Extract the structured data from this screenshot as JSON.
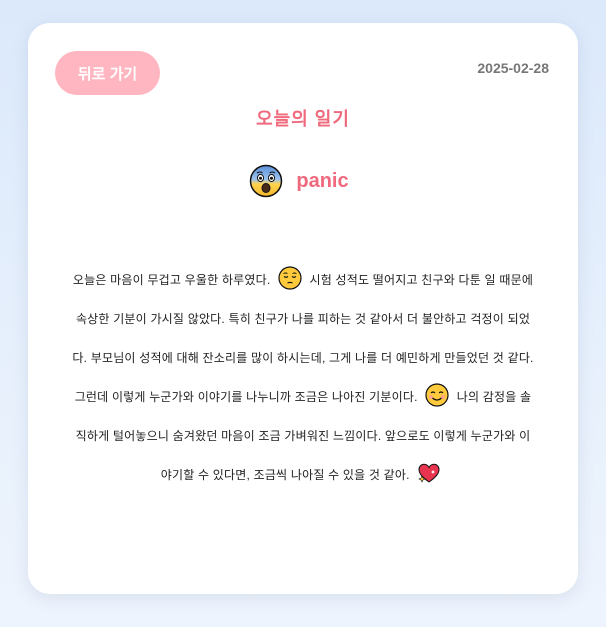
{
  "header": {
    "back_label": "뒤로 가기",
    "date": "2025-02-28"
  },
  "diary": {
    "title": "오늘의 일기",
    "emotion": {
      "icon": "screaming-face-icon",
      "label": "panic"
    },
    "segments": [
      "오늘은 마음이 무겁고 우울한 하루였다.",
      "시험 성적도 떨어지고 친구와 다툰 일 때문에 속상한 기분이 가시질 않았다. 특히 친구가 나를 피하는 것 같아서 더 불안하고 걱정이 되었다. 부모님이 성적에 대해 잔소리를 많이 하시는데, 그게 나를 더 예민하게 만들었던 것 같다. 그런데 이렇게 누군가와 이야기를 나누니까 조금은 나아진 기분이다.",
      "나의 감정을 솔직하게 털어놓으니 숨겨왔던 마음이 조금 가벼워진 느낌이다. 앞으로도 이렇게 누군가와 이야기할 수 있다면, 조금씩 나아질 수 있을 것 같아."
    ],
    "inline_icons": [
      "pensive-face-icon",
      "smiling-face-icon",
      "sparkling-heart-icon"
    ]
  },
  "colors": {
    "accent": "#f06a7e",
    "button_bg": "#ffb6c1",
    "date_text": "#777777",
    "background": "#dbe9fb"
  }
}
